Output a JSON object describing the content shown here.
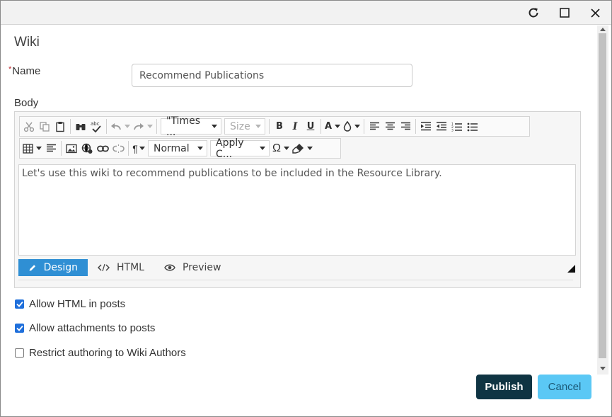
{
  "dialog": {
    "title": "Wiki"
  },
  "form": {
    "name_label": "Name",
    "required_marker": "*",
    "name_value": "Recommend Publications",
    "body_label": "Body"
  },
  "editor": {
    "font_family_value": "\"Times ...",
    "font_size_value": "Size",
    "bold_label": "B",
    "italic_label": "I",
    "underline_label": "U",
    "font_color_label": "A",
    "paragraph_label": "¶",
    "block_format_value": "Normal",
    "css_class_value": "Apply C...",
    "symbol_label": "Ω",
    "content": "Let's use this wiki to recommend publications to be included in the Resource Library.",
    "modes": [
      "Design",
      "HTML",
      "Preview"
    ],
    "active_mode": "Design"
  },
  "options": [
    {
      "label": "Allow HTML in posts",
      "checked": true
    },
    {
      "label": "Allow attachments to posts",
      "checked": true
    },
    {
      "label": "Restrict authoring to Wiki Authors",
      "checked": false
    }
  ],
  "actions": {
    "publish_label": "Publish",
    "cancel_label": "Cancel"
  },
  "colors": {
    "publish_bg": "#0f3443",
    "cancel_bg": "#5bc8f5",
    "design_tab_bg": "#2f8fd4",
    "checkbox_on": "#1f6fdb"
  }
}
